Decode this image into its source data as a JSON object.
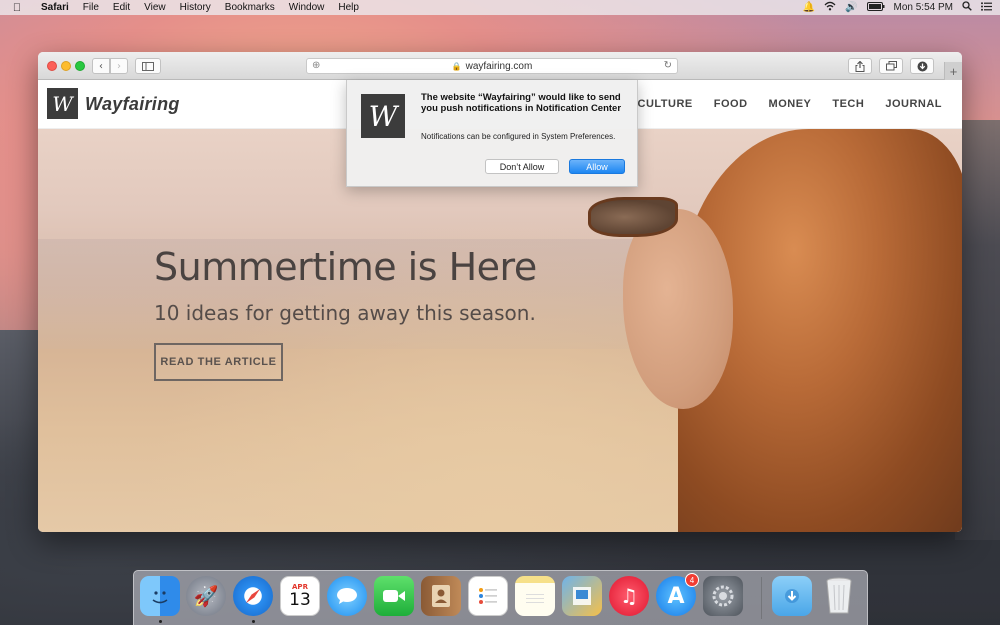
{
  "menubar": {
    "app_name": "Safari",
    "items": [
      "File",
      "Edit",
      "View",
      "History",
      "Bookmarks",
      "Window",
      "Help"
    ],
    "battery_icon": "battery-icon",
    "clock": "Mon 5:54 PM"
  },
  "browser": {
    "url": "wayfairing.com",
    "secure": true
  },
  "site": {
    "logo_letter": "W",
    "name": "Wayfairing",
    "nav": [
      "CULTURE",
      "FOOD",
      "MONEY",
      "TECH",
      "JOURNAL"
    ],
    "hero": {
      "title": "Summertime is Here",
      "subtitle": "10 ideas for getting away this season.",
      "cta": "READ THE ARTICLE"
    }
  },
  "notification": {
    "icon_letter": "W",
    "title": "The website “Wayfairing” would like to send you push notifications in Notification Center",
    "body": "Notifications can be configured in System Preferences.",
    "deny_label": "Don’t Allow",
    "allow_label": "Allow"
  },
  "dock": {
    "calendar_month": "APR",
    "calendar_day": "13",
    "app_store_badge": "4",
    "apps": [
      "finder",
      "launchpad",
      "safari",
      "calendar",
      "messages",
      "facetime",
      "contacts",
      "reminders",
      "notes",
      "preview",
      "itunes",
      "app-store",
      "system-preferences",
      "downloads",
      "trash"
    ]
  },
  "colors": {
    "accent_blue": "#1c86f2",
    "logo_dark": "#3c3c3c",
    "badge_red": "#f23c33"
  }
}
